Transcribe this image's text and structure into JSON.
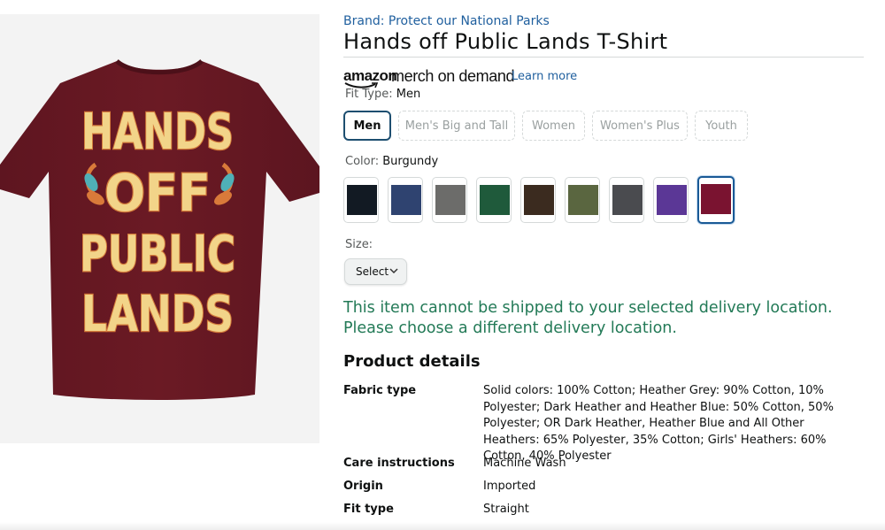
{
  "product_image": {
    "shirt_color": "#6b1a24",
    "design_lines": [
      "HANDS",
      "OFF",
      "PUBLIC",
      "LANDS"
    ]
  },
  "brand": {
    "label": "Brand: Protect our National Parks"
  },
  "title": "Hands off Public Lands T-Shirt",
  "merch": {
    "amazon": "amazon",
    "merch_text": "merch on demand",
    "learn_more": "Learn more"
  },
  "fit_type": {
    "label": "Fit Type:",
    "selected": "Men",
    "options": [
      "Men",
      "Men's Big and Tall",
      "Women",
      "Women's Plus",
      "Youth"
    ]
  },
  "color": {
    "label": "Color:",
    "selected": "Burgundy",
    "swatches": [
      "#121a23",
      "#2f4370",
      "#6c6c6a",
      "#1f5a3b",
      "#3b2b1f",
      "#5a6640",
      "#4a4b4f",
      "#5b3796",
      "#7a1330"
    ]
  },
  "size": {
    "label": "Size:",
    "select_label": "Select"
  },
  "warning": "This item cannot be shipped to your selected delivery location. Please choose a different delivery location.",
  "product_details": {
    "heading": "Product details",
    "rows": [
      {
        "key": "Fabric type",
        "value": "Solid colors: 100% Cotton; Heather Grey: 90% Cotton, 10% Polyester; Dark Heather and Heather Blue: 50% Cotton, 50% Polyester; OR Dark Heather, Heather Blue and All Other Heathers: 65% Polyester, 35% Cotton; Girls' Heathers: 60% Cotton, 40% Polyester"
      },
      {
        "key": "Care instructions",
        "value": "Machine Wash"
      },
      {
        "key": "Origin",
        "value": "Imported"
      },
      {
        "key": "Fit type",
        "value": "Straight"
      }
    ]
  }
}
